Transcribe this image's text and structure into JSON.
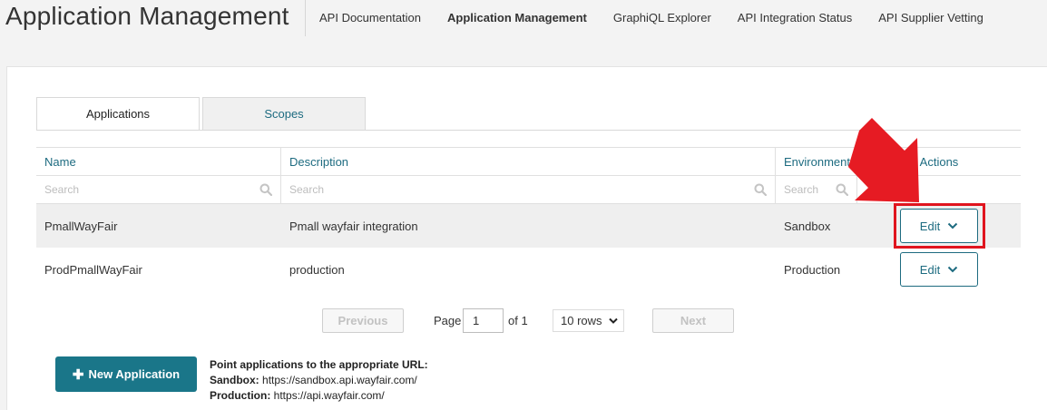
{
  "header": {
    "title": "Application Management",
    "nav": [
      {
        "label": "API Documentation",
        "active": false
      },
      {
        "label": "Application Management",
        "active": true
      },
      {
        "label": "GraphiQL Explorer",
        "active": false
      },
      {
        "label": "API Integration Status",
        "active": false
      },
      {
        "label": "API Supplier Vetting",
        "active": false
      }
    ]
  },
  "tabs": [
    {
      "label": "Applications",
      "active": true
    },
    {
      "label": "Scopes",
      "active": false
    }
  ],
  "table": {
    "columns": [
      "Name",
      "Description",
      "Environment",
      "Actions"
    ],
    "search_placeholder": "Search",
    "rows": [
      {
        "name": "PmallWayFair",
        "description": "Pmall wayfair integration",
        "environment": "Sandbox",
        "action": "Edit"
      },
      {
        "name": "ProdPmallWayFair",
        "description": "production",
        "environment": "Production",
        "action": "Edit"
      }
    ]
  },
  "pagination": {
    "previous": "Previous",
    "next": "Next",
    "page_label": "Page",
    "page_value": "1",
    "of_label": "of 1",
    "rows_option": "10 rows"
  },
  "new_application": {
    "label": "New Application"
  },
  "url_info": {
    "heading": "Point applications to the appropriate URL:",
    "sandbox_label": "Sandbox:",
    "sandbox_url": "https://sandbox.api.wayfair.com/",
    "production_label": "Production:",
    "production_url": "https://api.wayfair.com/"
  },
  "colors": {
    "accent": "#1d6b80",
    "primary_button": "#1a7689",
    "highlight": "#e0141e"
  }
}
